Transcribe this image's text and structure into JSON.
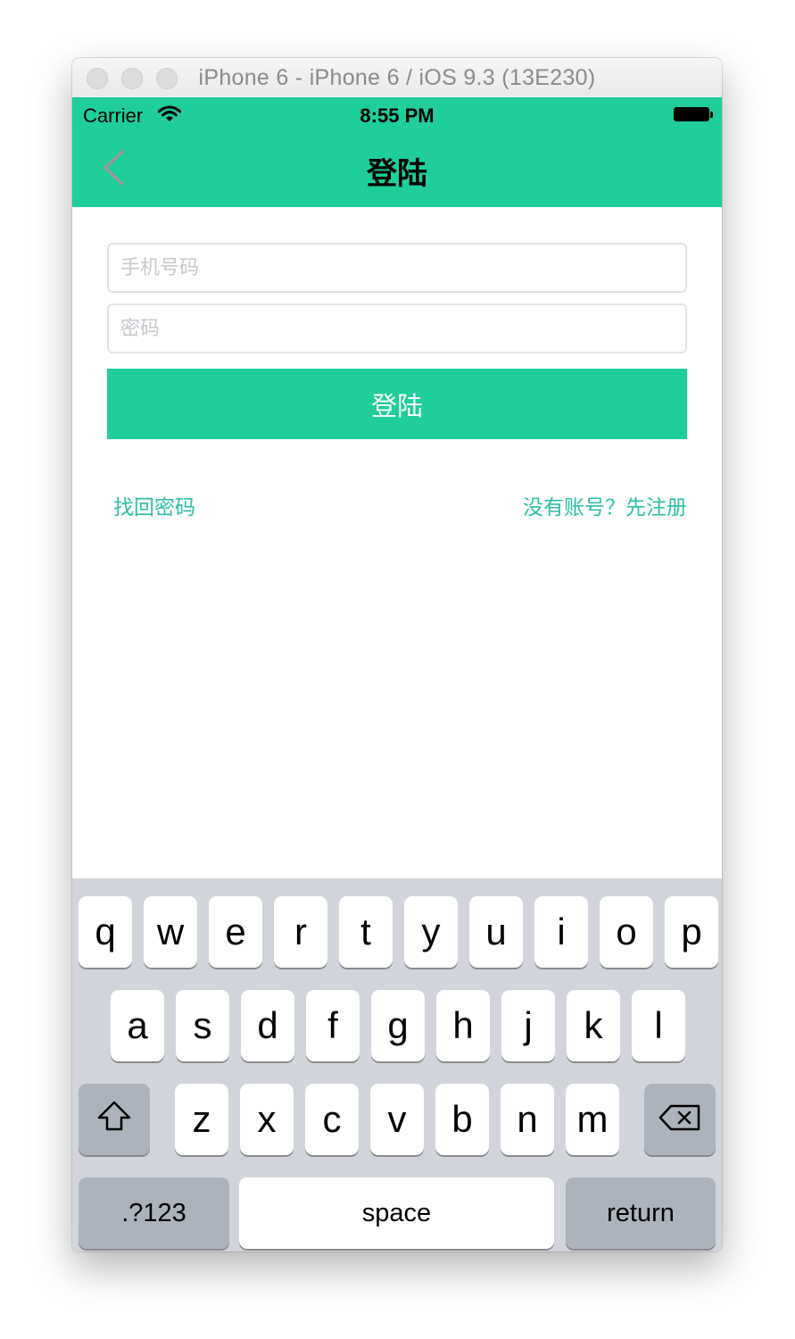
{
  "window": {
    "title": "iPhone 6 - iPhone 6 / iOS 9.3 (13E230)"
  },
  "status_bar": {
    "carrier": "Carrier",
    "time": "8:55 PM"
  },
  "navbar": {
    "title": "登陆",
    "back_icon": "chevron-left-icon"
  },
  "form": {
    "phone_placeholder": "手机号码",
    "phone_value": "",
    "password_placeholder": "密码",
    "password_value": "",
    "login_label": "登陆"
  },
  "links": {
    "forgot_password": "找回密码",
    "register": "没有账号？先注册"
  },
  "keyboard": {
    "row1": [
      "q",
      "w",
      "e",
      "r",
      "t",
      "y",
      "u",
      "i",
      "o",
      "p"
    ],
    "row2": [
      "a",
      "s",
      "d",
      "f",
      "g",
      "h",
      "j",
      "k",
      "l"
    ],
    "row3": [
      "z",
      "x",
      "c",
      "v",
      "b",
      "n",
      "m"
    ],
    "shift_icon": "shift-icon",
    "delete_icon": "backspace-icon",
    "numbers_label": ".?123",
    "space_label": "space",
    "return_label": "return"
  },
  "colors": {
    "accent": "#1fce9a",
    "link": "#2bbfa6",
    "keyboard_bg": "#d1d5db",
    "back_icon": "#999999"
  }
}
